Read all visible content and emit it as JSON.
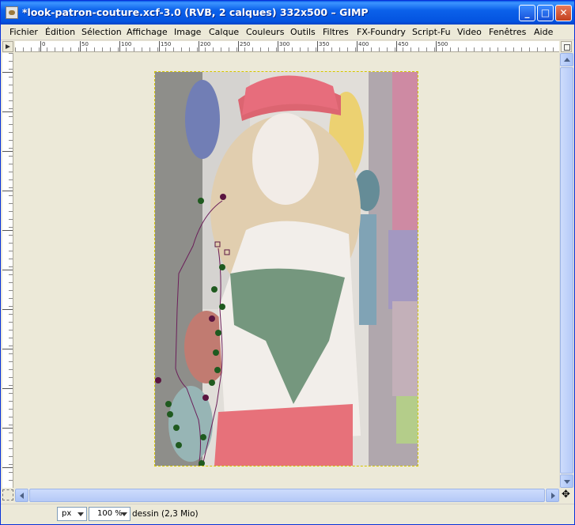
{
  "window": {
    "title": "*look-patron-couture.xcf-3.0 (RVB, 2 calques) 332x500 – GIMP",
    "minimize_glyph": "_",
    "maximize_glyph": "□",
    "close_glyph": "✕"
  },
  "menu": {
    "items": [
      {
        "label": "Fichier"
      },
      {
        "label": "Édition"
      },
      {
        "label": "Sélection"
      },
      {
        "label": "Affichage"
      },
      {
        "label": "Image"
      },
      {
        "label": "Calque"
      },
      {
        "label": "Couleurs"
      },
      {
        "label": "Outils"
      },
      {
        "label": "Filtres"
      },
      {
        "label": "FX-Foundry"
      },
      {
        "label": "Script-Fu"
      },
      {
        "label": "Video"
      },
      {
        "label": "Fenêtres"
      },
      {
        "label": "Aide"
      }
    ]
  },
  "rulers": {
    "horizontal_labels": [
      "0",
      "50",
      "100",
      "150",
      "200",
      "250",
      "300",
      "350",
      "400",
      "450",
      "500"
    ]
  },
  "statusbar": {
    "unit": "px",
    "zoom": "100 %",
    "layer_info": "dessin (2,3 Mio)"
  },
  "colors": {
    "titlebar": "#0453e0",
    "canvas_bg": "#ece9d8",
    "path_stroke": "#6b1f5a",
    "anchor_green": "#1f5a1f",
    "anchor_purple": "#5a1540"
  }
}
